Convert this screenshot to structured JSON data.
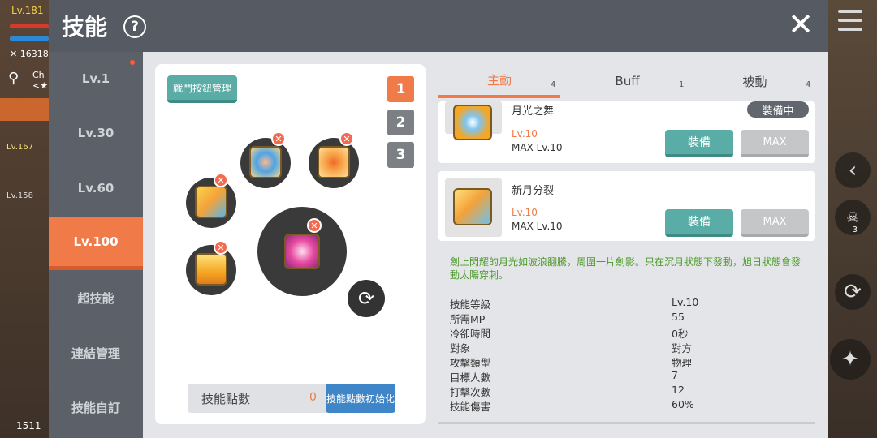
{
  "hud": {
    "level": "Lv.181",
    "power": "16318",
    "channel_line1": "Ch",
    "channel_line2": "<★",
    "lv_a": "Lv.167",
    "lv_b": "Lv.158",
    "bottom": "1511",
    "side_count": "3"
  },
  "window": {
    "title": "技能",
    "help": "?",
    "close": "✕"
  },
  "sidebar": {
    "items": [
      {
        "label": "Lv.1"
      },
      {
        "label": "Lv.30"
      },
      {
        "label": "Lv.60"
      },
      {
        "label": "Lv.100"
      },
      {
        "label": "超技能"
      },
      {
        "label": "連結管理"
      },
      {
        "label": "技能自訂"
      }
    ],
    "active": "Lv.100"
  },
  "left": {
    "mgmt_button": "戰鬥按鈕管理",
    "presets": [
      "1",
      "2",
      "3"
    ],
    "active_preset": "1",
    "remove_symbol": "✕",
    "points_label": "技能點數",
    "points_value": "0",
    "reset_button": "技能點數初始化"
  },
  "tabs": [
    {
      "label": "主動",
      "count": "4"
    },
    {
      "label": "Buff",
      "count": "1"
    },
    {
      "label": "被動",
      "count": "4"
    }
  ],
  "skills": [
    {
      "name": "月光之舞",
      "level": "Lv.10",
      "max": "MAX Lv.10",
      "badge": "裝備中",
      "equip": "裝備",
      "max_btn": "MAX"
    },
    {
      "name": "新月分裂",
      "level": "Lv.10",
      "max": "MAX Lv.10",
      "equip": "裝備",
      "max_btn": "MAX"
    }
  ],
  "detail": {
    "description": "劍上閃耀的月光如波浪翻騰，周圍一片劍影。只在沉月狀態下發動，旭日狀態會發動太陽穿刺。",
    "stats": [
      {
        "key": "技能等級",
        "value": "Lv.10"
      },
      {
        "key": "所需MP",
        "value": "55"
      },
      {
        "key": "冷卻時間",
        "value": "0秒"
      },
      {
        "key": "對象",
        "value": "對方"
      },
      {
        "key": "攻擊類型",
        "value": "物理"
      },
      {
        "key": "目標人數",
        "value": "7"
      },
      {
        "key": "打擊次數",
        "value": "12"
      },
      {
        "key": "技能傷害",
        "value": "60%"
      }
    ]
  },
  "colors": {
    "accent": "#f07a48",
    "teal": "#5aada6",
    "blue": "#3f86c8",
    "desc_green": "#4c9a2a"
  }
}
